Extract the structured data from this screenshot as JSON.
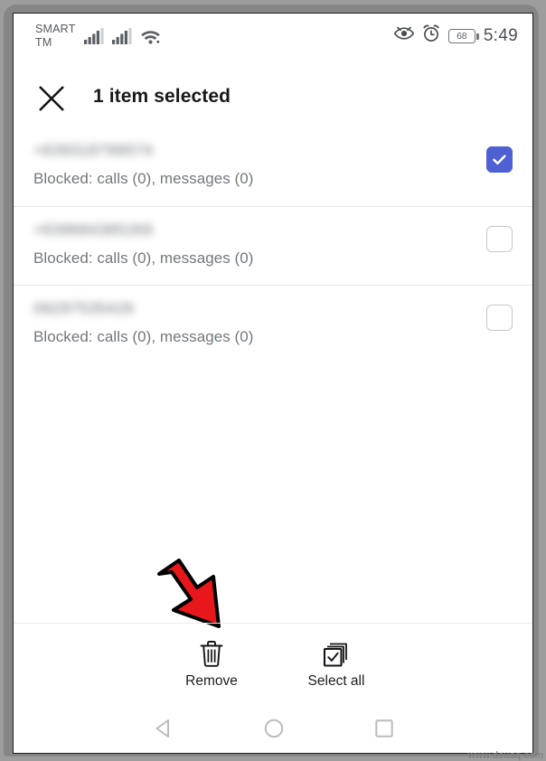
{
  "status_bar": {
    "carrier_line1": "SMART",
    "carrier_line2": "TM",
    "signal_icon_1": "cellular-signal-icon",
    "signal_icon_2": "cellular-signal-icon",
    "wifi_icon": "wifi-icon",
    "eye_icon": "eye-comfort-icon",
    "alarm_icon": "alarm-clock-icon",
    "battery_level": "68",
    "time": "5:49"
  },
  "app_bar": {
    "close_icon": "close-icon",
    "title": "1 item selected"
  },
  "list": {
    "items": [
      {
        "number": "+639318799574",
        "subtitle": "Blocked: calls (0), messages (0)",
        "checked": true
      },
      {
        "number": "+639684385269",
        "subtitle": "Blocked: calls (0), messages (0)",
        "checked": false
      },
      {
        "number": "09297535426",
        "subtitle": "Blocked: calls (0), messages (0)",
        "checked": false
      }
    ]
  },
  "annotation": {
    "arrow_icon": "red-arrow-down-right-icon",
    "arrow_color": "#e8171b",
    "arrow_outline_color": "#000000"
  },
  "action_bar": {
    "remove": {
      "icon": "trash-icon",
      "label": "Remove"
    },
    "select_all": {
      "icon": "select-all-checkbox-icon",
      "label": "Select all"
    }
  },
  "nav_bar": {
    "back": "back-triangle-icon",
    "home": "home-circle-icon",
    "recents": "recents-square-icon"
  },
  "watermark": {
    "text": "www.deuaq.com"
  },
  "colors": {
    "checkbox_accent": "#4f5fd4",
    "text_primary": "#16181a",
    "text_secondary": "#73787d",
    "divider": "#e6e6e6"
  }
}
